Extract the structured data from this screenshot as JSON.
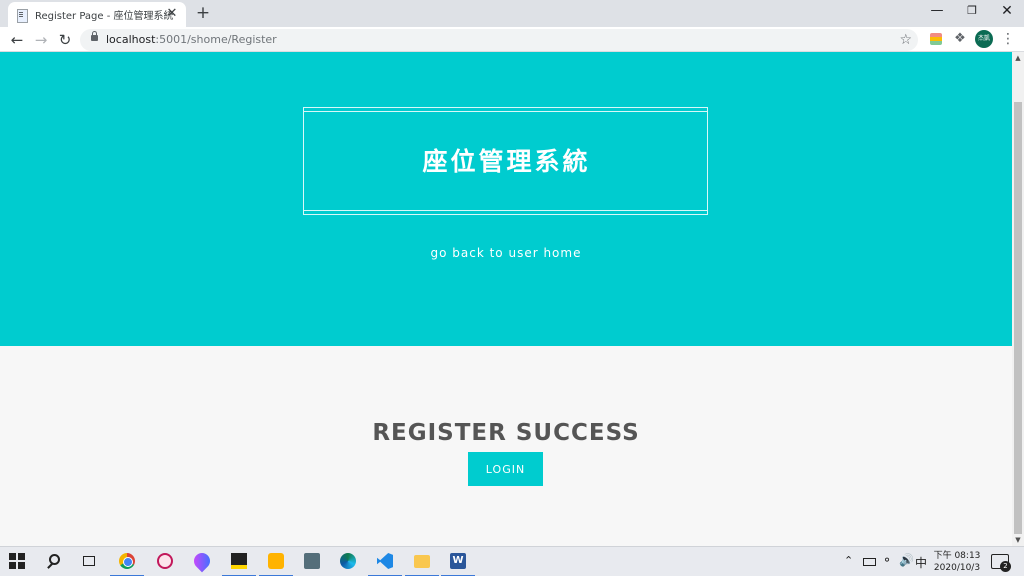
{
  "browser": {
    "tab_title": "Register Page - 座位管理系統",
    "tab_close": "✕",
    "new_tab": "+",
    "url_host": "localhost",
    "url_path": ":5001/shome/Register",
    "avatar_label": "杰凱"
  },
  "page": {
    "site_title": "座位管理系統",
    "back_link": "go back to user home",
    "heading": "REGISTER SUCCESS",
    "login_button": "LOGIN"
  },
  "colors": {
    "accent": "#00cccf",
    "heading_text": "#555555",
    "page_background": "#f7f7f7"
  },
  "taskbar": {
    "apps": [
      "start",
      "search",
      "task-view",
      "chrome",
      "paint-3d",
      "droplet",
      "sticky-notes",
      "snipping-tool",
      "calculator",
      "edge",
      "vscode",
      "file-explorer",
      "word"
    ],
    "ime": "中",
    "time": "下午 08:13",
    "date": "2020/10/3",
    "notification_count": "2"
  }
}
